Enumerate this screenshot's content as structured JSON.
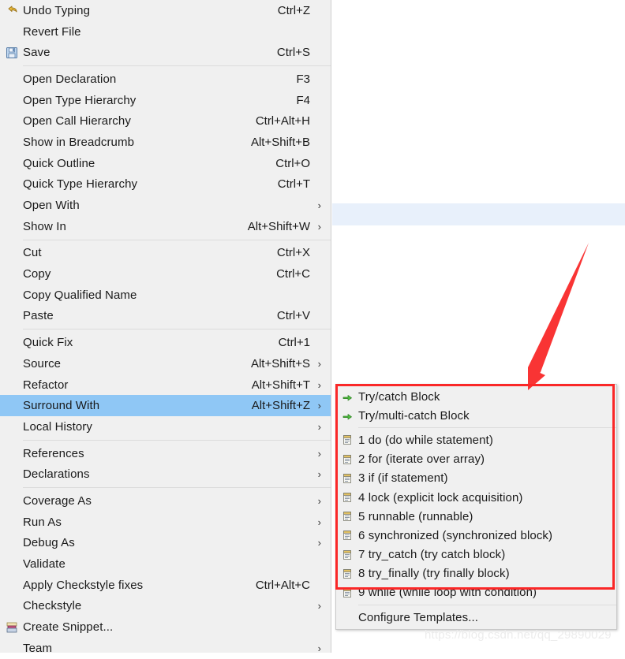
{
  "app": {
    "kind": "eclipse-context-menu",
    "watermark": "https://blog.csdn.net/qq_29890029"
  },
  "colors": {
    "menu_background": "#f0f0f0",
    "menu_selected": "#8fc7f5",
    "separator": "#dcdcdc",
    "annotation_red": "#fa2828",
    "editor_line_highlight": "#e8f0fb",
    "text": "#1a1a1a"
  },
  "context_menu": {
    "groups": [
      {
        "items": [
          {
            "label": "Undo Typing",
            "accel": "Ctrl+Z",
            "icon": "undo-icon",
            "submenu": false
          },
          {
            "label": "Revert File",
            "accel": "",
            "icon": "",
            "submenu": false
          },
          {
            "label": "Save",
            "accel": "Ctrl+S",
            "icon": "save-icon",
            "submenu": false
          }
        ]
      },
      {
        "items": [
          {
            "label": "Open Declaration",
            "accel": "F3",
            "icon": "",
            "submenu": false
          },
          {
            "label": "Open Type Hierarchy",
            "accel": "F4",
            "icon": "",
            "submenu": false
          },
          {
            "label": "Open Call Hierarchy",
            "accel": "Ctrl+Alt+H",
            "icon": "",
            "submenu": false
          },
          {
            "label": "Show in Breadcrumb",
            "accel": "Alt+Shift+B",
            "icon": "",
            "submenu": false
          },
          {
            "label": "Quick Outline",
            "accel": "Ctrl+O",
            "icon": "",
            "submenu": false
          },
          {
            "label": "Quick Type Hierarchy",
            "accel": "Ctrl+T",
            "icon": "",
            "submenu": false
          },
          {
            "label": "Open With",
            "accel": "",
            "icon": "",
            "submenu": true
          },
          {
            "label": "Show In",
            "accel": "Alt+Shift+W",
            "icon": "",
            "submenu": true
          }
        ]
      },
      {
        "items": [
          {
            "label": "Cut",
            "accel": "Ctrl+X",
            "icon": "",
            "submenu": false
          },
          {
            "label": "Copy",
            "accel": "Ctrl+C",
            "icon": "",
            "submenu": false
          },
          {
            "label": "Copy Qualified Name",
            "accel": "",
            "icon": "",
            "submenu": false
          },
          {
            "label": "Paste",
            "accel": "Ctrl+V",
            "icon": "",
            "submenu": false
          }
        ]
      },
      {
        "items": [
          {
            "label": "Quick Fix",
            "accel": "Ctrl+1",
            "icon": "",
            "submenu": false
          },
          {
            "label": "Source",
            "accel": "Alt+Shift+S",
            "icon": "",
            "submenu": true
          },
          {
            "label": "Refactor",
            "accel": "Alt+Shift+T",
            "icon": "",
            "submenu": true
          },
          {
            "label": "Surround With",
            "accel": "Alt+Shift+Z",
            "icon": "",
            "submenu": true,
            "selected": true
          },
          {
            "label": "Local History",
            "accel": "",
            "icon": "",
            "submenu": true
          }
        ]
      },
      {
        "items": [
          {
            "label": "References",
            "accel": "",
            "icon": "",
            "submenu": true
          },
          {
            "label": "Declarations",
            "accel": "",
            "icon": "",
            "submenu": true
          }
        ]
      },
      {
        "items": [
          {
            "label": "Coverage As",
            "accel": "",
            "icon": "",
            "submenu": true
          },
          {
            "label": "Run As",
            "accel": "",
            "icon": "",
            "submenu": true
          },
          {
            "label": "Debug As",
            "accel": "",
            "icon": "",
            "submenu": true
          },
          {
            "label": "Validate",
            "accel": "",
            "icon": "",
            "submenu": false
          },
          {
            "label": "Apply Checkstyle fixes",
            "accel": "Ctrl+Alt+C",
            "icon": "",
            "submenu": false
          },
          {
            "label": "Checkstyle",
            "accel": "",
            "icon": "",
            "submenu": true
          },
          {
            "label": "Create Snippet...",
            "accel": "",
            "icon": "snippet-icon",
            "submenu": false
          },
          {
            "label": "Team",
            "accel": "",
            "icon": "",
            "submenu": true
          }
        ]
      }
    ]
  },
  "submenu": {
    "title": "Surround With",
    "groups": [
      {
        "items": [
          {
            "label": "Try/catch Block",
            "icon": "green-arrow-icon"
          },
          {
            "label": "Try/multi-catch Block",
            "icon": "green-arrow-icon"
          }
        ]
      },
      {
        "items": [
          {
            "label": "1 do (do while statement)",
            "icon": "template-icon"
          },
          {
            "label": "2 for (iterate over array)",
            "icon": "template-icon"
          },
          {
            "label": "3 if (if statement)",
            "icon": "template-icon"
          },
          {
            "label": "4 lock (explicit lock acquisition)",
            "icon": "template-icon"
          },
          {
            "label": "5 runnable (runnable)",
            "icon": "template-icon"
          },
          {
            "label": "6 synchronized (synchronized block)",
            "icon": "template-icon"
          },
          {
            "label": "7 try_catch (try catch block)",
            "icon": "template-icon"
          },
          {
            "label": "8 try_finally (try finally block)",
            "icon": "template-icon"
          },
          {
            "label": "9 while (while loop with condition)",
            "icon": "template-icon"
          }
        ]
      },
      {
        "items": [
          {
            "label": "Configure Templates...",
            "icon": ""
          }
        ]
      }
    ]
  },
  "annotations": {
    "arrow": {
      "label": "red-pointer-arrow",
      "color": "#fa2828"
    },
    "box": {
      "label": "red-highlight-box",
      "color": "#fa2828"
    }
  }
}
